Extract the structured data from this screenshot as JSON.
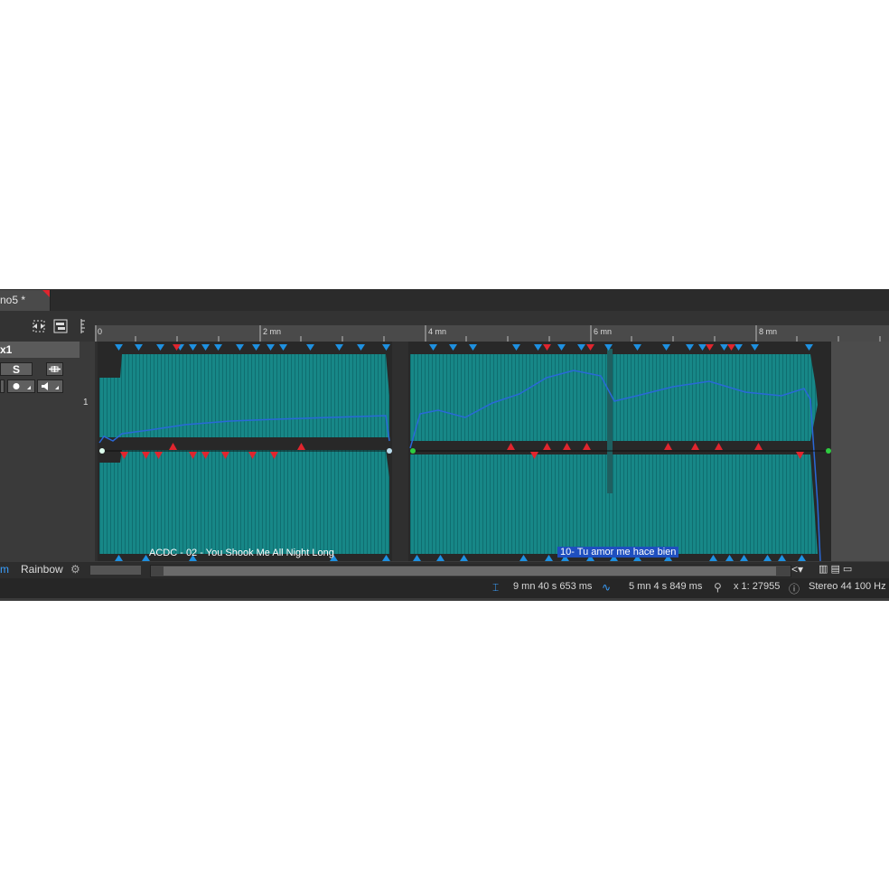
{
  "tab": {
    "title": "no5 *"
  },
  "track": {
    "name": "x1",
    "number": "1",
    "solo_label": "S"
  },
  "ruler": {
    "marks": [
      "0",
      "2 mn",
      "4 mn",
      "6 mn",
      "8 mn"
    ]
  },
  "clips": [
    {
      "label": "ACDC - 02 - You Shook Me All Night Long"
    },
    {
      "label": "10- Tu amor me hace bien"
    }
  ],
  "bottom": {
    "left_label": "m",
    "rainbow_label": "Rainbow"
  },
  "status": {
    "position": "9 mn 40 s 653 ms",
    "length": "5 mn 4 s 849 ms",
    "zoom": "x 1: 27955",
    "format": "Stereo 44 100 Hz"
  },
  "colors": {
    "waveform": "#1a8a8a",
    "envelope": "#2a68d8",
    "marker_blue": "#1e90e0",
    "marker_red": "#e0252e",
    "tab_accent": "#e0252e"
  },
  "icons": [
    "fit-icon",
    "tracks-icon",
    "ruler-icon",
    "record-icon",
    "speaker-icon",
    "collapse-icon",
    "settings-icon",
    "share-icon",
    "view-icon",
    "cursor-icon",
    "waveform-icon",
    "zoom-icon",
    "info-icon"
  ]
}
